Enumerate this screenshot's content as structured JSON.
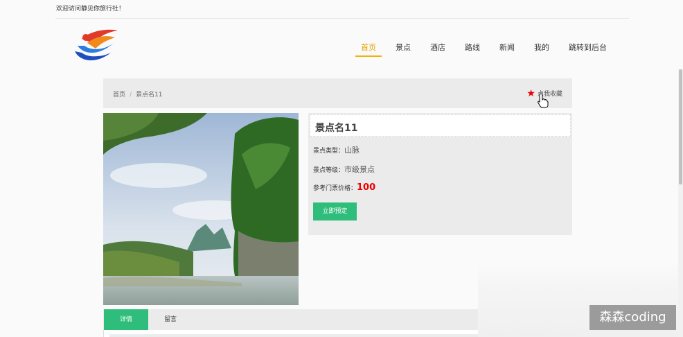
{
  "header": {
    "welcome": "欢迎访问静见你旅行社！"
  },
  "nav": {
    "items": [
      {
        "label": "首页"
      },
      {
        "label": "景点"
      },
      {
        "label": "酒店"
      },
      {
        "label": "路线"
      },
      {
        "label": "新闻"
      },
      {
        "label": "我的"
      },
      {
        "label": "跳转到后台"
      }
    ],
    "active_index": 0,
    "accent_color": "#f0b400"
  },
  "breadcrumb": {
    "home": "首页",
    "separator": "/",
    "current": "景点名11"
  },
  "favorite": {
    "label": "点我收藏",
    "icon": "star-icon"
  },
  "detail": {
    "title": "景点名11",
    "type_label": "景点类型：",
    "type_value": "山脉",
    "level_label": "景点等级：",
    "level_value": "市级景点",
    "price_label": "参考门票价格：",
    "price_value": "100",
    "book_label": "立即预定",
    "book_color": "#2fbd7b"
  },
  "tabs": {
    "items": [
      {
        "label": "详情"
      },
      {
        "label": "留言"
      }
    ],
    "active_index": 0
  },
  "watermark": {
    "text": "森森coding"
  }
}
